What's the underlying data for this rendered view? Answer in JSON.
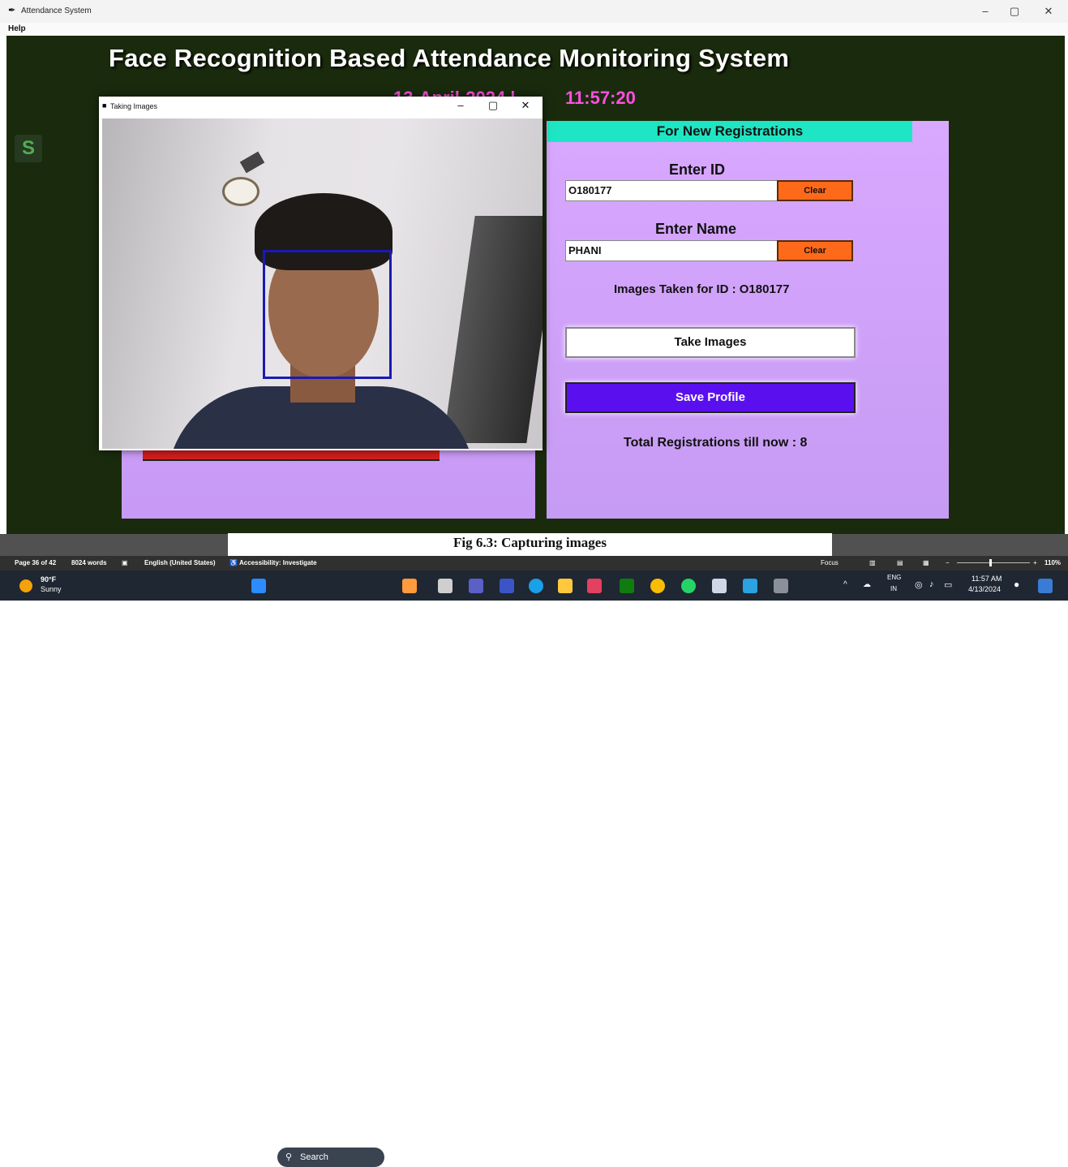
{
  "window": {
    "title": "Attendance System",
    "menu": [
      "Help"
    ],
    "controls": {
      "minimize": "–",
      "maximize": "▢",
      "close": "✕"
    }
  },
  "app": {
    "title": "Face Recognition Based Attendance Monitoring System",
    "date": "13-April-2024  |",
    "time": "11:57:20"
  },
  "camera_window": {
    "title": "Taking Images",
    "controls": {
      "minimize": "–",
      "maximize": "▢",
      "close": "✕"
    }
  },
  "registration": {
    "header": "For New Registrations",
    "id_label": "Enter ID",
    "id_value": "O180177",
    "name_label": "Enter Name",
    "name_value": "PHANI",
    "clear_label": "Clear",
    "images_taken": "Images Taken for ID : O180177",
    "take_images": "Take Images",
    "save_profile": "Save Profile",
    "total_registrations": "Total Registrations till now  : 8"
  },
  "caption": "Fig 6.3: Capturing images",
  "statusbar": {
    "page": "Page 36 of 42",
    "words": "8024 words",
    "language": "English (United States)",
    "accessibility": "Accessibility: Investigate",
    "focus": "Focus",
    "zoom": "110%"
  },
  "taskbar": {
    "weather_temp": "90°F",
    "weather_desc": "Sunny",
    "search": "Search",
    "lang_top": "ENG",
    "lang_bottom": "IN",
    "time": "11:57 AM",
    "date": "4/13/2024"
  },
  "colors": {
    "app_bg": "#1a2b0d",
    "panel": "#c99cf6",
    "header": "#1ee6c4",
    "clear": "#ff6a1a",
    "save": "#5a10ee",
    "datetime": "#ff4fe0"
  }
}
